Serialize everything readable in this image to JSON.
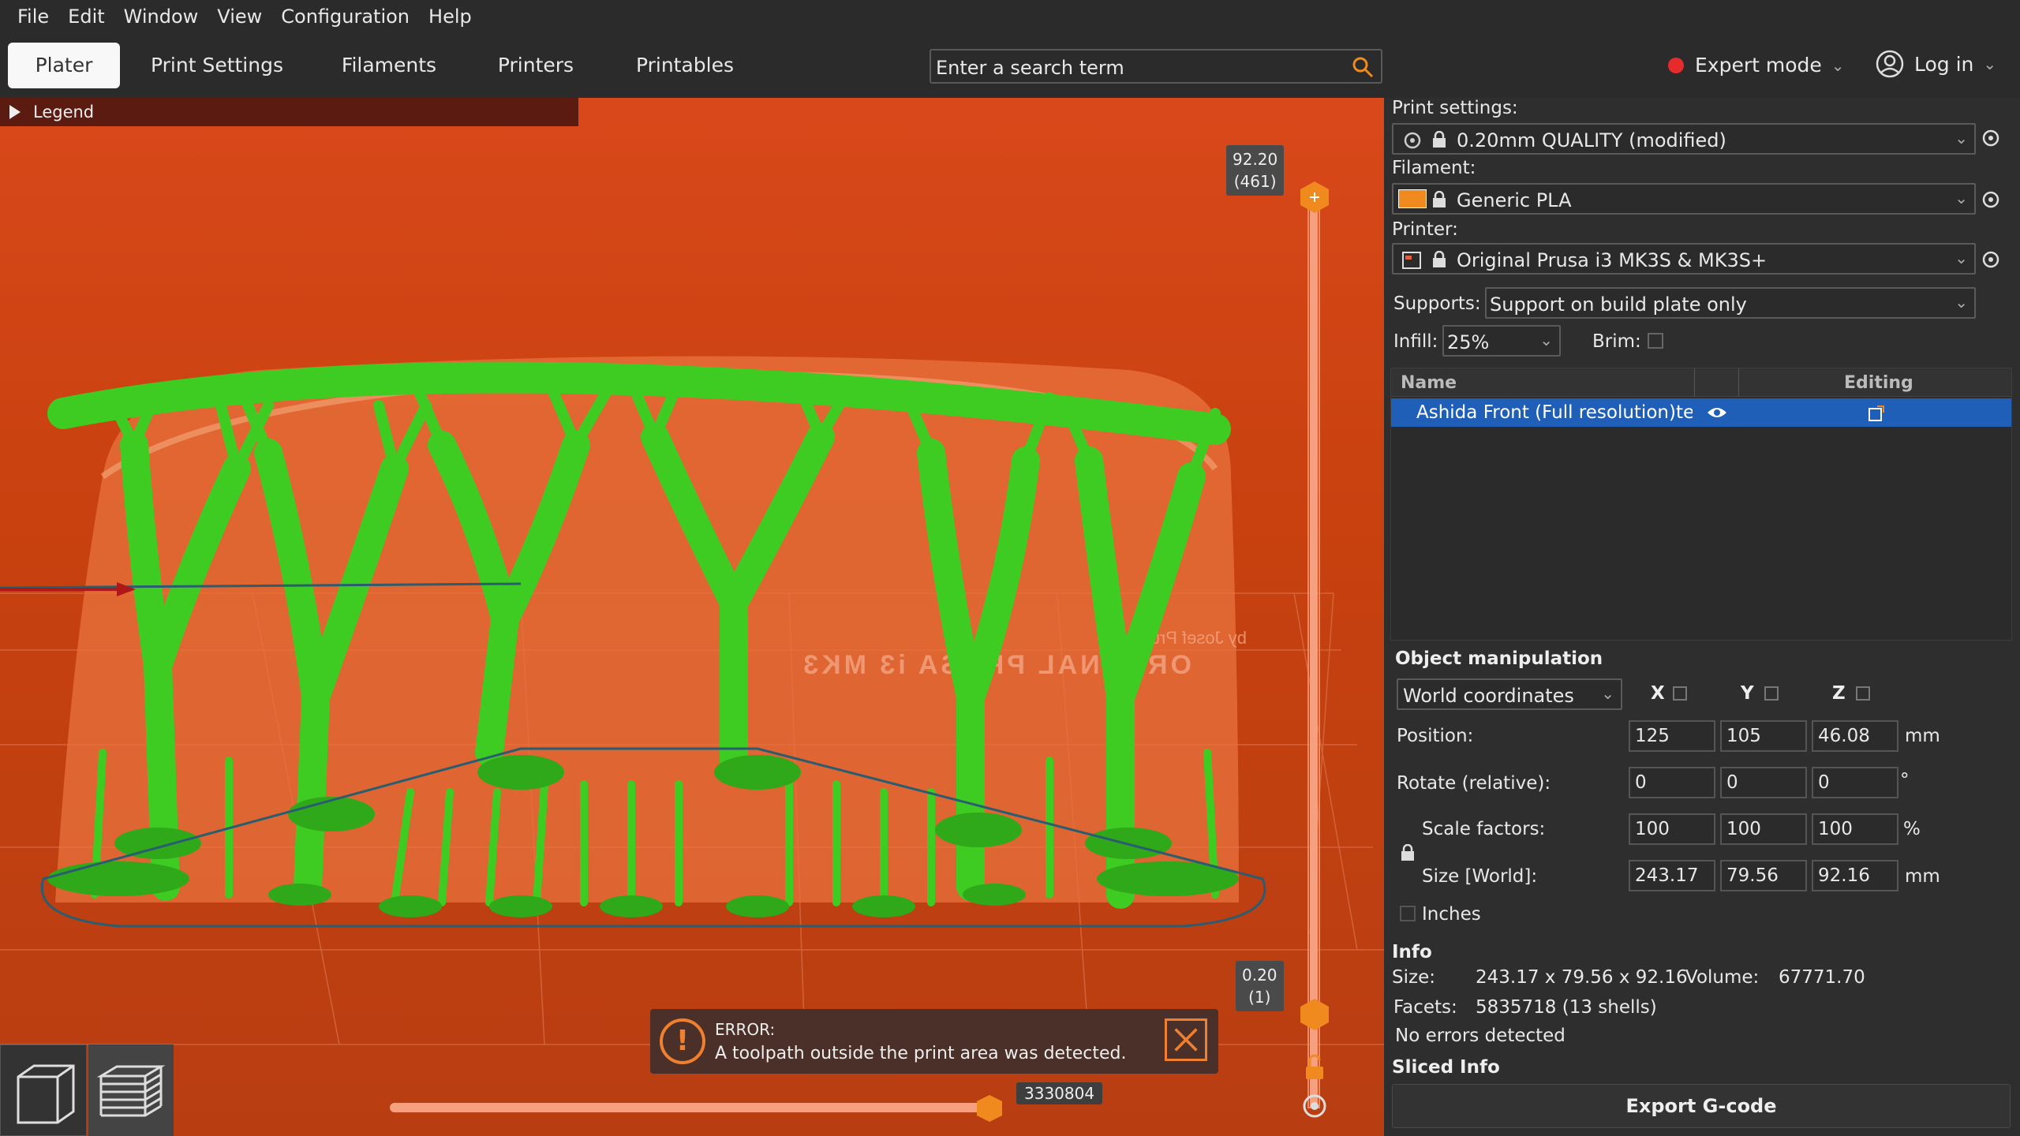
{
  "menu": [
    "File",
    "Edit",
    "Window",
    "View",
    "Configuration",
    "Help"
  ],
  "tabs": [
    "Plater",
    "Print Settings",
    "Filaments",
    "Printers",
    "Printables"
  ],
  "search": {
    "placeholder": "Enter a search term"
  },
  "mode": {
    "label": "Expert mode",
    "color": "#e52b2b"
  },
  "login": {
    "label": "Log in"
  },
  "viewport": {
    "legend_label": "Legend",
    "bed_text": "ORIGINAL PRUSA i3 MK3",
    "bed_text_small": "by Josef Prusa",
    "top_layer": {
      "height": "92.20",
      "layer": "(461)"
    },
    "bottom_layer": {
      "height": "0.20",
      "layer": "(1)"
    },
    "move_value": "3330804",
    "model_color": "#3fcc22",
    "error": {
      "title": "ERROR:",
      "message": "A toolpath outside the print area was detected."
    }
  },
  "panel": {
    "print_settings_label": "Print settings:",
    "print_settings_value": "0.20mm QUALITY (modified)",
    "filament_label": "Filament:",
    "filament_value": "Generic PLA",
    "filament_color": "#f08a1e",
    "printer_label": "Printer:",
    "printer_value": "Original Prusa i3 MK3S & MK3S+",
    "supports_label": "Supports:",
    "supports_value": "Support on build plate only",
    "infill_label": "Infill:",
    "infill_value": "25%",
    "brim_label": "Brim:",
    "list_header_name": "Name",
    "list_header_editing": "Editing",
    "object_name": "Ashida Front (Full resolution)te",
    "object_manipulation": "Object manipulation",
    "coords": "World coordinates",
    "axes": [
      "X",
      "Y",
      "Z"
    ],
    "position_label": "Position:",
    "position": [
      "125",
      "105",
      "46.08"
    ],
    "position_unit": "mm",
    "rotate_label": "Rotate (relative):",
    "rotate": [
      "0",
      "0",
      "0"
    ],
    "rotate_unit": "°",
    "scale_label": "Scale factors:",
    "scale": [
      "100",
      "100",
      "100"
    ],
    "scale_unit": "%",
    "size_label": "Size [World]:",
    "size": [
      "243.17",
      "79.56",
      "92.16"
    ],
    "size_unit": "mm",
    "inches_label": "Inches",
    "info_title": "Info",
    "size_info_label": "Size:",
    "size_info_value": "243.17 x 79.56 x 92.16",
    "volume_label": "Volume:",
    "volume_value": "67771.70",
    "facets_label": "Facets:",
    "facets_value": "5835718 (13 shells)",
    "errors_text": "No errors detected",
    "sliced_info": "Sliced Info",
    "export_label": "Export G-code"
  }
}
